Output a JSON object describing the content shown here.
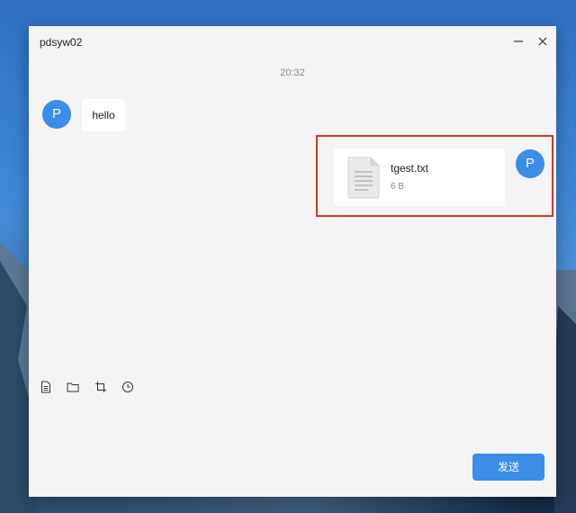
{
  "window": {
    "title": "pdsyw02",
    "minimize_icon": "minimize-icon",
    "close_icon": "close-icon"
  },
  "chat": {
    "timestamp": "20:32",
    "messages": [
      {
        "sender_initial": "P",
        "type": "text",
        "text": "hello"
      },
      {
        "sender_initial": "P",
        "type": "file",
        "file_name": "tgest.txt",
        "file_size": "6 B"
      }
    ]
  },
  "toolbar": {
    "tools": [
      "document-icon",
      "folder-icon",
      "crop-icon",
      "clock-icon"
    ]
  },
  "send_button": {
    "label": "发送"
  },
  "colors": {
    "accent": "#3a8ee8",
    "highlight": "#d1342b",
    "window_bg": "#f4f4f4"
  }
}
